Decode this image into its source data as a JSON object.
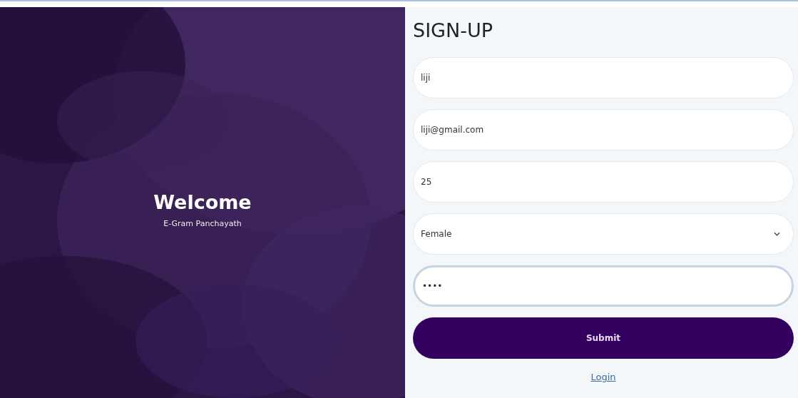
{
  "hero": {
    "kind": "picture",
    "title": "Welcome",
    "subtitle": "E-Gram Panchayath"
  },
  "form": {
    "title": "SIGN-UP",
    "fields": [
      {
        "kind": "text",
        "value": "liji",
        "focused": false
      },
      {
        "kind": "text",
        "value": "liji@gmail.com",
        "focused": false
      },
      {
        "kind": "text",
        "value": "25",
        "focused": false
      },
      {
        "kind": "select",
        "value": "Female",
        "focused": false
      },
      {
        "kind": "text",
        "value": "••••",
        "focused": true
      }
    ],
    "submit": "Submit",
    "link": "Login"
  }
}
